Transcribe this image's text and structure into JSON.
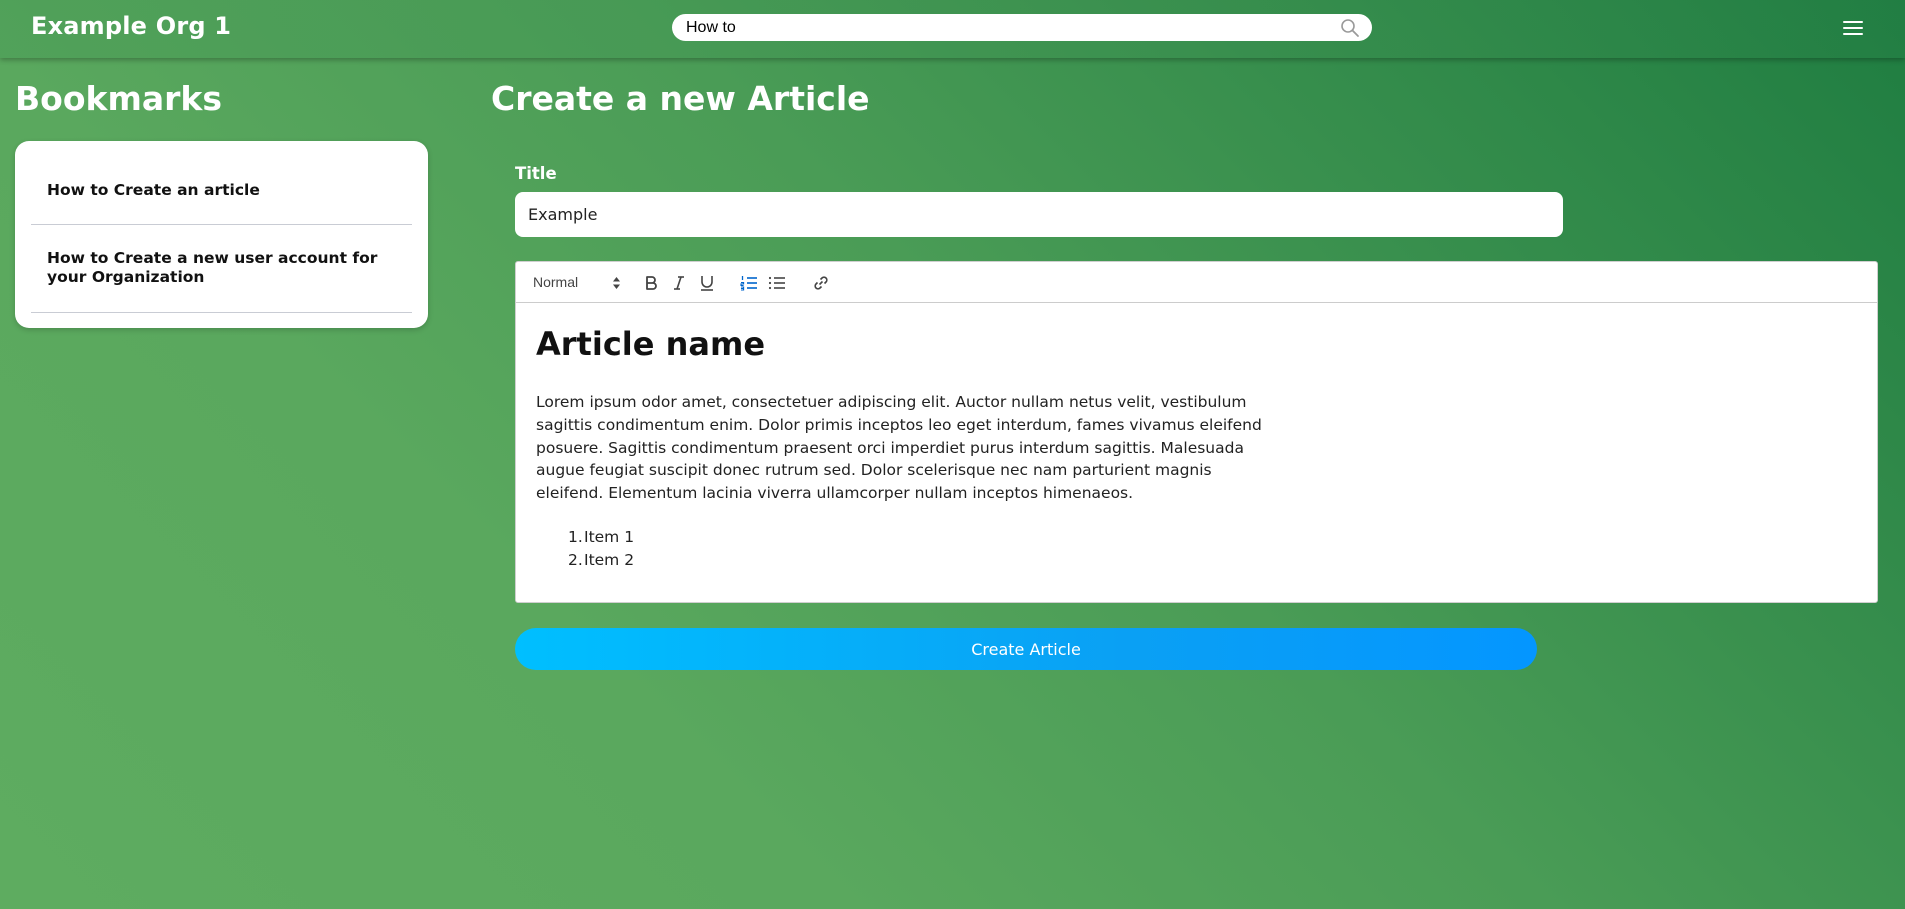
{
  "header": {
    "org_name": "Example Org 1",
    "search_value": "How to",
    "search_icon": "search-icon",
    "menu_icon": "hamburger-menu-icon"
  },
  "sidebar": {
    "heading": "Bookmarks",
    "items": [
      {
        "label": "How to Create an article"
      },
      {
        "label_line1": "How to Create a new user account for",
        "label_line2": "your Organization"
      }
    ]
  },
  "main": {
    "heading": "Create a new Article",
    "title_label": "Title",
    "title_value": "Example",
    "editor": {
      "toolbar": {
        "format_value": "Normal",
        "buttons": [
          "bold-icon",
          "italic-icon",
          "underline-icon",
          "ordered-list-icon",
          "bullet-list-icon",
          "link-icon"
        ],
        "active_color": "#06c"
      },
      "content": {
        "heading": "Article name",
        "paragraph_lines": [
          "Lorem ipsum odor amet, consectetuer adipiscing elit. Auctor nullam netus velit, vestibulum",
          "sagittis condimentum enim. Dolor primis inceptos leo eget interdum, fames vivamus eleifend",
          "posuere. Sagittis condimentum praesent orci imperdiet purus interdum sagittis. Malesuada",
          "augue feugiat suscipit donec rutrum sed. Dolor scelerisque nec nam parturient magnis",
          "eleifend. Elementum lacinia viverra ullamcorper nullam inceptos himenaeos."
        ],
        "list_items": [
          {
            "num": "1.",
            "text": "Item 1"
          },
          {
            "num": "2.",
            "text": "Item 2"
          }
        ]
      }
    },
    "create_button_label": "Create Article"
  },
  "colors": {
    "bg_start": "#5eac60",
    "bg_end": "#1f7d41",
    "button_start": "#00bfff",
    "button_end": "#0496ff"
  }
}
